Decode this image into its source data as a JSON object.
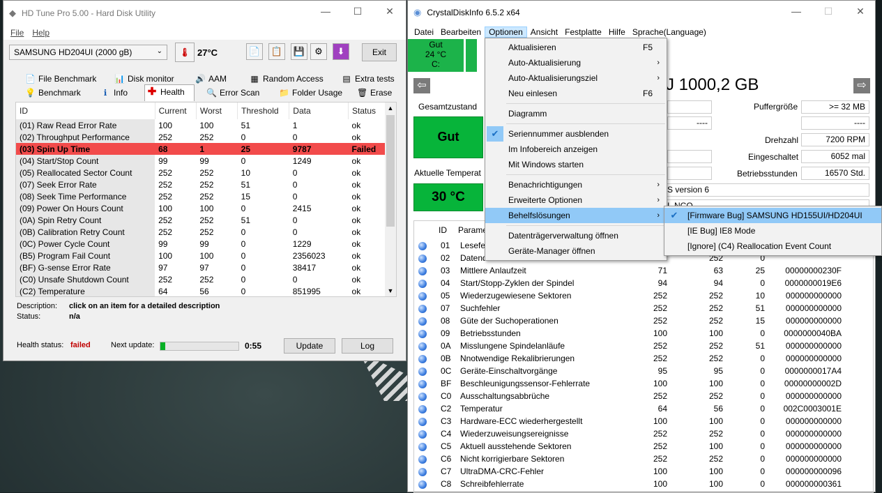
{
  "hdtune": {
    "title": "HD Tune Pro 5.00 - Hard Disk Utility",
    "menu": [
      "File",
      "Help"
    ],
    "drive": "SAMSUNG HD204UI (2000 gB)",
    "temperature": "27°C",
    "exit": "Exit",
    "tabs_row1": [
      "File Benchmark",
      "Disk monitor",
      "AAM",
      "Random Access",
      "Extra tests"
    ],
    "tabs_row2": [
      "Benchmark",
      "Info",
      "Health",
      "Error Scan",
      "Folder Usage",
      "Erase"
    ],
    "columns": [
      "ID",
      "Current",
      "Worst",
      "Threshold",
      "Data",
      "Status"
    ],
    "rows": [
      [
        "(01) Raw Read Error Rate",
        "100",
        "100",
        "51",
        "1",
        "ok"
      ],
      [
        "(02) Throughput Performance",
        "252",
        "252",
        "0",
        "0",
        "ok"
      ],
      [
        "(03) Spin Up Time",
        "68",
        "1",
        "25",
        "9787",
        "Failed"
      ],
      [
        "(04) Start/Stop Count",
        "99",
        "99",
        "0",
        "1249",
        "ok"
      ],
      [
        "(05) Reallocated Sector Count",
        "252",
        "252",
        "10",
        "0",
        "ok"
      ],
      [
        "(07) Seek Error Rate",
        "252",
        "252",
        "51",
        "0",
        "ok"
      ],
      [
        "(08) Seek Time Performance",
        "252",
        "252",
        "15",
        "0",
        "ok"
      ],
      [
        "(09) Power On Hours Count",
        "100",
        "100",
        "0",
        "2415",
        "ok"
      ],
      [
        "(0A) Spin Retry Count",
        "252",
        "252",
        "51",
        "0",
        "ok"
      ],
      [
        "(0B) Calibration Retry Count",
        "252",
        "252",
        "0",
        "0",
        "ok"
      ],
      [
        "(0C) Power Cycle Count",
        "99",
        "99",
        "0",
        "1229",
        "ok"
      ],
      [
        "(B5) Program Fail Count",
        "100",
        "100",
        "0",
        "2356023",
        "ok"
      ],
      [
        "(BF) G-sense Error Rate",
        "97",
        "97",
        "0",
        "38417",
        "ok"
      ],
      [
        "(C0) Unsafe Shutdown Count",
        "252",
        "252",
        "0",
        "0",
        "ok"
      ],
      [
        "(C2) Temperature",
        "64",
        "56",
        "0",
        "851995",
        "ok"
      ]
    ],
    "description_label": "Description:",
    "description_value": "click on an item for a detailed description",
    "status_label": "Status:",
    "status_value": "n/a",
    "health_label": "Health status:",
    "health_value": "failed",
    "next_update_label": "Next update:",
    "progress_fraction": 0.06,
    "timer": "0:55",
    "update_btn": "Update",
    "log_btn": "Log"
  },
  "cdi": {
    "title": "CrystalDiskInfo 6.5.2 x64",
    "menu": [
      "Datei",
      "Bearbeiten",
      "Optionen",
      "Ansicht",
      "Festplatte",
      "Hilfe",
      "Sprache(Language)"
    ],
    "tile_status": "Gut",
    "tile_temp": "24 °C",
    "tile_drive": "C:",
    "capacity": "J 1000,2 GB",
    "gesamtzustand": "Gesamtzustand",
    "health_big": "Gut",
    "aktuelle_temp": "Aktuelle Temperat",
    "temp_big": "30 °C",
    "right_labels": [
      "Puffergröße",
      "",
      "Drehzahl",
      "Eingeschaltet",
      "Betriebsstunden"
    ],
    "right_values": [
      ">= 32 MB",
      "----",
      "7200 RPM",
      "6052 mal",
      "16570 Std."
    ],
    "left_values": [
      "----"
    ],
    "standard_text": "S version 6",
    "features_text": "I, NCQ",
    "list_header": [
      "",
      "ID",
      "Parame"
    ],
    "list_rows": [
      [
        "01",
        "Lesefe",
        "",
        "",
        "",
        ""
      ],
      [
        "02",
        "Datend",
        "52",
        "252",
        "0",
        ""
      ],
      [
        "03",
        "Mittlere Anlaufzeit",
        "71",
        "63",
        "25",
        "00000000230F"
      ],
      [
        "04",
        "Start/Stopp-Zyklen der Spindel",
        "94",
        "94",
        "0",
        "0000000019E6"
      ],
      [
        "05",
        "Wiederzugewiesene Sektoren",
        "252",
        "252",
        "10",
        "000000000000"
      ],
      [
        "07",
        "Suchfehler",
        "252",
        "252",
        "51",
        "000000000000"
      ],
      [
        "08",
        "Güte der Suchoperationen",
        "252",
        "252",
        "15",
        "000000000000"
      ],
      [
        "09",
        "Betriebsstunden",
        "100",
        "100",
        "0",
        "0000000040BA"
      ],
      [
        "0A",
        "Misslungene Spindelanläufe",
        "252",
        "252",
        "51",
        "000000000000"
      ],
      [
        "0B",
        "Nnotwendige Rekalibrierungen",
        "252",
        "252",
        "0",
        "000000000000"
      ],
      [
        "0C",
        "Geräte-Einschaltvorgänge",
        "95",
        "95",
        "0",
        "0000000017A4"
      ],
      [
        "BF",
        "Beschleunigungssensor-Fehlerrate",
        "100",
        "100",
        "0",
        "00000000002D"
      ],
      [
        "C0",
        "Ausschaltungsabbrüche",
        "252",
        "252",
        "0",
        "000000000000"
      ],
      [
        "C2",
        "Temperatur",
        "64",
        "56",
        "0",
        "002C0003001E"
      ],
      [
        "C3",
        "Hardware-ECC wiederhergestellt",
        "100",
        "100",
        "0",
        "000000000000"
      ],
      [
        "C4",
        "Wiederzuweisungsereignisse",
        "252",
        "252",
        "0",
        "000000000000"
      ],
      [
        "C5",
        "Aktuell ausstehende Sektoren",
        "252",
        "100",
        "0",
        "000000000000"
      ],
      [
        "C6",
        "Nicht korrigierbare Sektoren",
        "252",
        "252",
        "0",
        "000000000000"
      ],
      [
        "C7",
        "UltraDMA-CRC-Fehler",
        "100",
        "100",
        "0",
        "000000000096"
      ],
      [
        "C8",
        "Schreibfehlerrate",
        "100",
        "100",
        "0",
        "000000000361"
      ]
    ]
  },
  "options_menu": {
    "items": [
      {
        "label": "Aktualisieren",
        "shortcut": "F5"
      },
      {
        "label": "Auto-Aktualisierung",
        "sub": true
      },
      {
        "label": "Auto-Aktualisierungsziel",
        "sub": true
      },
      {
        "label": "Neu einlesen",
        "shortcut": "F6"
      },
      {
        "sep": true
      },
      {
        "label": "Diagramm"
      },
      {
        "sep": true
      },
      {
        "label": "Seriennummer ausblenden",
        "checked": true
      },
      {
        "label": "Im Infobereich anzeigen"
      },
      {
        "label": "Mit Windows starten"
      },
      {
        "sep": true
      },
      {
        "label": "Benachrichtigungen",
        "sub": true
      },
      {
        "label": "Erweiterte Optionen",
        "sub": true
      },
      {
        "label": "Behelfslösungen",
        "sub": true,
        "highlight": true
      },
      {
        "sep": true
      },
      {
        "label": "Datenträgerverwaltung öffnen"
      },
      {
        "label": "Geräte-Manager öffnen"
      }
    ],
    "submenu": [
      {
        "label": "[Firmware Bug] SAMSUNG HD155UI/HD204UI",
        "checked": true
      },
      {
        "label": "[IE Bug] IE8 Mode"
      },
      {
        "label": "[Ignore] (C4) Reallocation Event Count"
      }
    ]
  },
  "colors": {
    "fail_row": "#f24b4b",
    "good": "#07b43a",
    "menu_highlight": "#91c9f7"
  }
}
